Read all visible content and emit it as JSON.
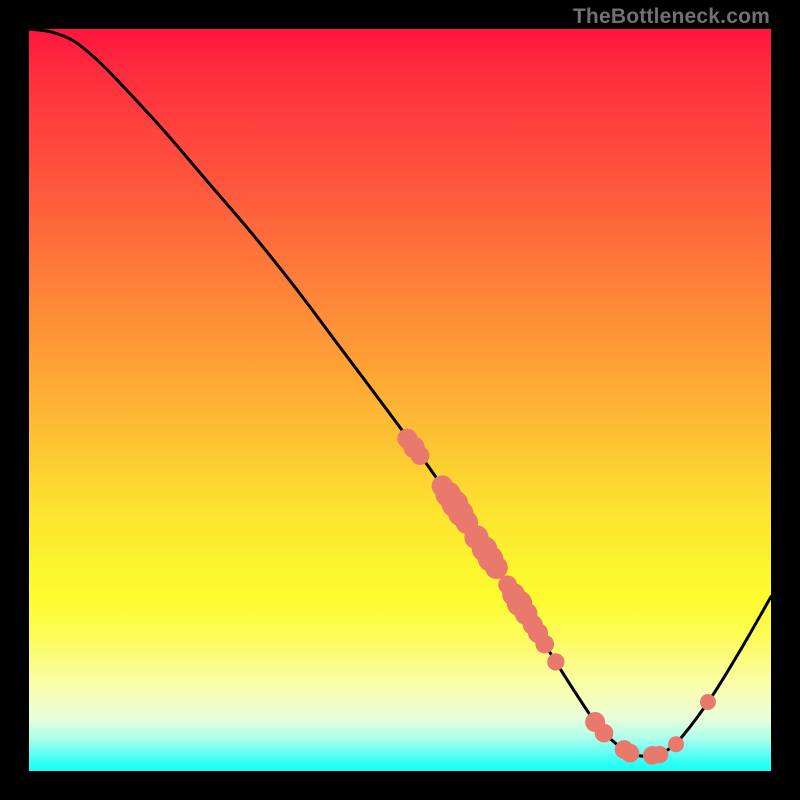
{
  "watermark": "TheBottleneck.com",
  "chart_data": {
    "type": "line",
    "title": "",
    "xlabel": "",
    "ylabel": "",
    "xlim": [
      0,
      100
    ],
    "ylim": [
      0,
      100
    ],
    "grid": false,
    "legend": false,
    "curve": [
      {
        "x": 0,
        "y": 100
      },
      {
        "x": 3,
        "y": 99.6
      },
      {
        "x": 6,
        "y": 98.4
      },
      {
        "x": 9,
        "y": 96.0
      },
      {
        "x": 12,
        "y": 93.0
      },
      {
        "x": 18,
        "y": 86.5
      },
      {
        "x": 24,
        "y": 79.5
      },
      {
        "x": 30,
        "y": 72.5
      },
      {
        "x": 36,
        "y": 65.0
      },
      {
        "x": 42,
        "y": 57.0
      },
      {
        "x": 48,
        "y": 49.0
      },
      {
        "x": 54,
        "y": 40.8
      },
      {
        "x": 60,
        "y": 32.0
      },
      {
        "x": 66,
        "y": 22.8
      },
      {
        "x": 70,
        "y": 16.3
      },
      {
        "x": 74,
        "y": 10.0
      },
      {
        "x": 77,
        "y": 5.7
      },
      {
        "x": 80,
        "y": 3.0
      },
      {
        "x": 82,
        "y": 2.1
      },
      {
        "x": 84,
        "y": 2.1
      },
      {
        "x": 86,
        "y": 2.8
      },
      {
        "x": 88,
        "y": 4.6
      },
      {
        "x": 92,
        "y": 10.0
      },
      {
        "x": 96,
        "y": 16.5
      },
      {
        "x": 100,
        "y": 23.5
      }
    ],
    "markers": [
      {
        "x": 51.0,
        "y": 44.8,
        "r": 1.0
      },
      {
        "x": 51.9,
        "y": 43.6,
        "r": 1.1
      },
      {
        "x": 52.7,
        "y": 42.5,
        "r": 0.9
      },
      {
        "x": 55.7,
        "y": 38.4,
        "r": 1.1
      },
      {
        "x": 56.5,
        "y": 37.3,
        "r": 1.4
      },
      {
        "x": 57.4,
        "y": 36.0,
        "r": 1.5
      },
      {
        "x": 58.2,
        "y": 34.7,
        "r": 1.4
      },
      {
        "x": 59.0,
        "y": 33.5,
        "r": 1.2
      },
      {
        "x": 60.3,
        "y": 31.5,
        "r": 1.3
      },
      {
        "x": 61.4,
        "y": 29.9,
        "r": 1.4
      },
      {
        "x": 62.2,
        "y": 28.6,
        "r": 1.4
      },
      {
        "x": 63.0,
        "y": 27.4,
        "r": 1.2
      },
      {
        "x": 64.5,
        "y": 25.1,
        "r": 0.9
      },
      {
        "x": 65.3,
        "y": 23.8,
        "r": 1.2
      },
      {
        "x": 66.1,
        "y": 22.6,
        "r": 1.4
      },
      {
        "x": 67.0,
        "y": 21.2,
        "r": 1.2
      },
      {
        "x": 67.9,
        "y": 19.7,
        "r": 1.0
      },
      {
        "x": 68.6,
        "y": 18.6,
        "r": 1.0
      },
      {
        "x": 69.5,
        "y": 17.1,
        "r": 0.9
      },
      {
        "x": 71.0,
        "y": 14.7,
        "r": 0.8
      },
      {
        "x": 76.3,
        "y": 6.6,
        "r": 1.0
      },
      {
        "x": 77.5,
        "y": 5.1,
        "r": 0.9
      },
      {
        "x": 80.2,
        "y": 2.9,
        "r": 0.9
      },
      {
        "x": 81.0,
        "y": 2.4,
        "r": 0.9
      },
      {
        "x": 84.0,
        "y": 2.1,
        "r": 0.9
      },
      {
        "x": 85.0,
        "y": 2.2,
        "r": 0.8
      },
      {
        "x": 87.2,
        "y": 3.6,
        "r": 0.7
      },
      {
        "x": 91.5,
        "y": 9.3,
        "r": 0.7
      }
    ],
    "marker_color": "#e9786d",
    "curve_color": "#000000"
  }
}
